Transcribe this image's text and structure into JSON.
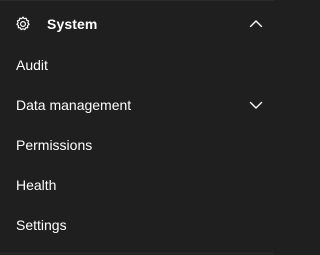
{
  "section": {
    "title": "System",
    "icon": "gear-icon",
    "expanded": true
  },
  "items": [
    {
      "label": "Audit"
    },
    {
      "label": "Data management",
      "has_children": true,
      "expanded": false
    },
    {
      "label": "Permissions"
    },
    {
      "label": "Health"
    },
    {
      "label": "Settings"
    }
  ],
  "colors": {
    "background": "#1f1f1f",
    "text": "#ffffff"
  }
}
